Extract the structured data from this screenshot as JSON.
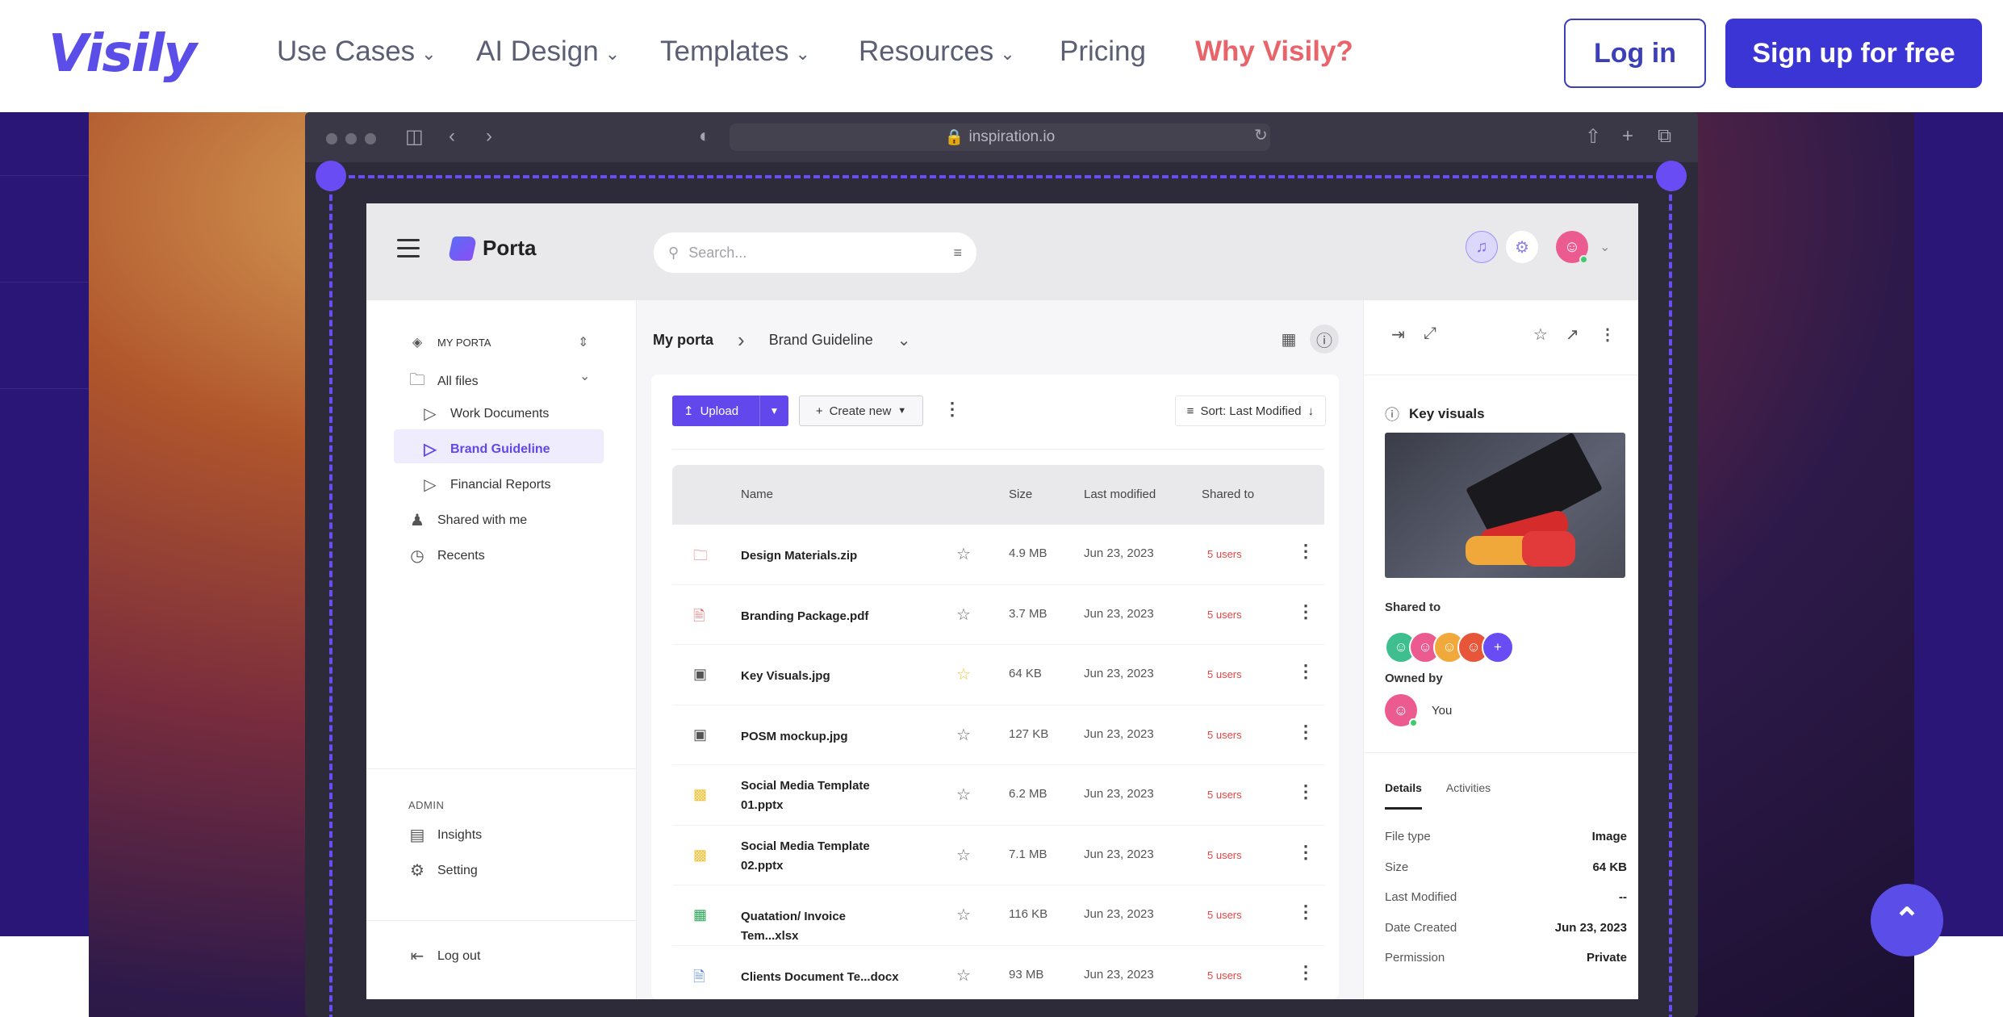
{
  "site": {
    "logo": "Visily",
    "nav": [
      "Use Cases",
      "AI Design",
      "Templates",
      "Resources"
    ],
    "pricing": "Pricing",
    "why": "Why Visily?",
    "login": "Log in",
    "signup": "Sign up for free",
    "colors": {
      "brand": "#3b35d6",
      "why": "#e8646a"
    }
  },
  "browser": {
    "url": "inspiration.io"
  },
  "app": {
    "name": "Porta",
    "search_placeholder": "Search...",
    "sidebar": {
      "section": "MY PORTA",
      "all_files": "All files",
      "folders": [
        "Work Documents",
        "Brand Guideline",
        "Financial Reports"
      ],
      "shared": "Shared with me",
      "recents": "Recents",
      "admin": "ADMIN",
      "insights": "Insights",
      "setting": "Setting",
      "logout": "Log out"
    },
    "breadcrumb": {
      "root": "My porta",
      "current": "Brand Guideline"
    },
    "toolbar": {
      "upload": "Upload",
      "create": "Create new",
      "sort": "Sort: Last Modified"
    },
    "table": {
      "headers": {
        "name": "Name",
        "size": "Size",
        "modified": "Last modified",
        "shared": "Shared to"
      },
      "rows": [
        {
          "name": "Design Materials.zip",
          "size": "4.9 MB",
          "date": "Jun 23, 2023",
          "users": "5 users",
          "icon": "folder-icon",
          "starred": false
        },
        {
          "name": "Branding Package.pdf",
          "size": "3.7 MB",
          "date": "Jun 23, 2023",
          "users": "5 users",
          "icon": "pdf-icon",
          "starred": false
        },
        {
          "name": "Key Visuals.jpg",
          "size": "64 KB",
          "date": "Jun 23, 2023",
          "users": "5 users",
          "icon": "image-icon",
          "starred": true
        },
        {
          "name": "POSM mockup.jpg",
          "size": "127 KB",
          "date": "Jun 23, 2023",
          "users": "5 users",
          "icon": "image-icon",
          "starred": false
        },
        {
          "name": "Social Media Template 01.pptx",
          "size": "6.2 MB",
          "date": "Jun 23, 2023",
          "users": "5 users",
          "icon": "slides-icon",
          "starred": false
        },
        {
          "name": "Social Media Template 02.pptx",
          "size": "7.1 MB",
          "date": "Jun 23, 2023",
          "users": "5 users",
          "icon": "slides-icon",
          "starred": false
        },
        {
          "name": "Quatation/ Invoice Tem...xlsx",
          "size": "116 KB",
          "date": "Jun 23, 2023",
          "users": "5 users",
          "icon": "sheet-icon",
          "starred": false
        },
        {
          "name": "Clients Document Te...docx",
          "size": "93 MB",
          "date": "Jun 23, 2023",
          "users": "5 users",
          "icon": "doc-icon",
          "starred": false
        }
      ]
    },
    "details": {
      "title": "Key visuals",
      "shared_to": "Shared to",
      "owned_by": "Owned by",
      "owner": "You",
      "tabs": [
        "Details",
        "Activities"
      ],
      "rows": [
        {
          "label": "File type",
          "value": "Image"
        },
        {
          "label": "Size",
          "value": "64 KB"
        },
        {
          "label": "Last Modified",
          "value": "--"
        },
        {
          "label": "Date Created",
          "value": "Jun 23, 2023"
        },
        {
          "label": "Permission",
          "value": "Private"
        }
      ]
    }
  }
}
